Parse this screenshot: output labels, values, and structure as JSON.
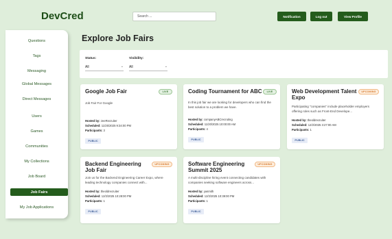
{
  "header": {
    "logo": "DevCred",
    "search_placeholder": "Search ...",
    "notification_label": "Notification",
    "logout_label": "Log out",
    "profile_label": "View Profile"
  },
  "sidebar": {
    "items": [
      {
        "label": "Questions"
      },
      {
        "label": "Tags"
      },
      {
        "label": "Messaging"
      },
      {
        "label": "Global Messages"
      },
      {
        "label": "Direct Messages"
      },
      {
        "label": "Users"
      },
      {
        "label": "Games"
      },
      {
        "label": "Communities"
      },
      {
        "label": "My Collections"
      },
      {
        "label": "Job Board"
      },
      {
        "label": "Job Fairs",
        "active": true
      },
      {
        "label": "My Job Applications"
      }
    ]
  },
  "main": {
    "title": "Explore Job Fairs",
    "filters": {
      "status_label": "Status:",
      "status_value": "All",
      "visibility_label": "Visibility:",
      "visibility_value": "All"
    },
    "cards": [
      {
        "title": "Google Job Fair",
        "badge": "LIVE",
        "description": "Job Fair For Google",
        "hosted_label": "Hosted by:",
        "hosted_by": "zeeRecruiter",
        "scheduled_label": "Scheduled:",
        "scheduled": "11/25/2025 9:34:00 PM",
        "participants_label": "Participants:",
        "participants": "3",
        "visibility": "PUBLIC"
      },
      {
        "title": "Coding Tournament for ABC",
        "badge": "LIVE",
        "description": "In this job fair we are looking for developers who can find the best solution to a problem we have.",
        "hosted_label": "Hosted by:",
        "hosted_by": "companyABCrecruting",
        "scheduled_label": "Scheduled:",
        "scheduled": "11/20/2025 10:00:00 AM",
        "participants_label": "Participants:",
        "participants": "4",
        "visibility": "PUBLIC"
      },
      {
        "title": "Web Development Talent Expo",
        "badge": "UPCOMING",
        "description": "Participating \"companies\" include placeholder employers offering roles such as Front-End Develope...",
        "hosted_label": "Hosted by:",
        "hosted_by": "theoldrecruiter",
        "scheduled_label": "Scheduled:",
        "scheduled": "12/2/2025 3:27:00 AM",
        "participants_label": "Participants:",
        "participants": "1",
        "visibility": "PUBLIC"
      },
      {
        "title": "Backend Engineering Job Fair",
        "badge": "UPCOMING",
        "description": "Join us for the Backend Engineering Career Expo, where leading technology companies connect with...",
        "hosted_label": "Hosted by:",
        "hosted_by": "theoldrecruiter",
        "scheduled_label": "Scheduled:",
        "scheduled": "12/2/2025 10:28:00 PM",
        "participants_label": "Participants:",
        "participants": "1",
        "visibility": "PUBLIC"
      },
      {
        "title": "Software Engineering Summit 2025",
        "badge": "UPCOMING",
        "description": "A multi-discipline hiring event connecting candidates with companies seeking software engineers across...",
        "hosted_label": "Hosted by:",
        "hosted_by": "yasmith",
        "scheduled_label": "Scheduled:",
        "scheduled": "12/2/2025 10:39:00 PM",
        "participants_label": "Participants:",
        "participants": "1",
        "visibility": "PUBLIC"
      }
    ]
  },
  "colors": {
    "brand": "#245c1c",
    "background": "#dfeedb",
    "live": "#3f7a37",
    "upcoming": "#d8792e",
    "chip": "#44639a"
  }
}
